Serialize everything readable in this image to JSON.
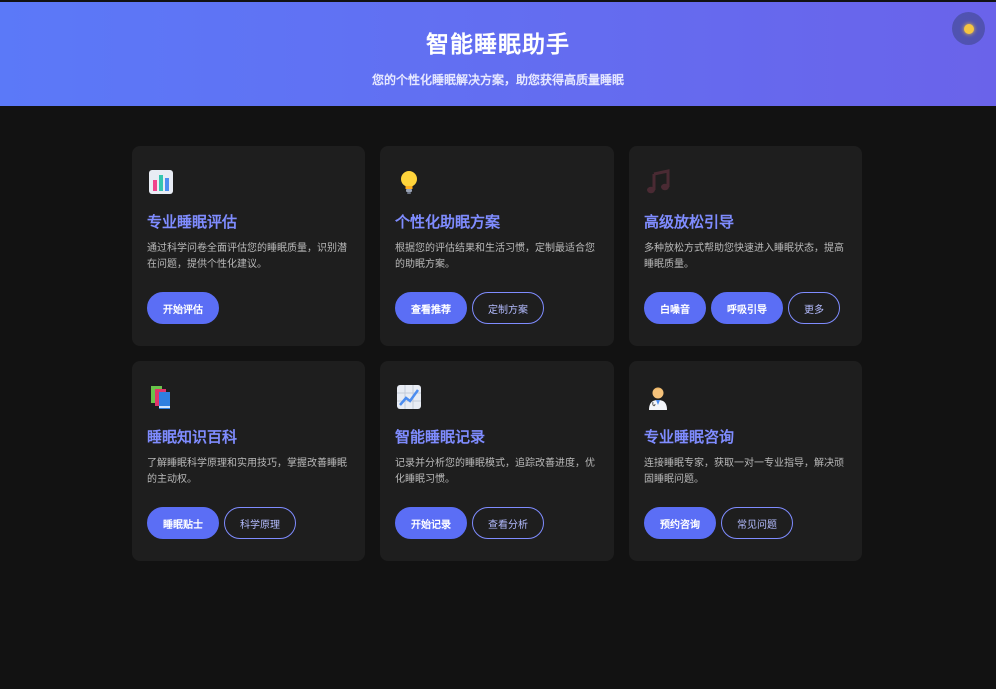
{
  "header": {
    "title": "智能睡眠助手",
    "subtitle": "您的个性化睡眠解决方案，助您获得高质量睡眠"
  },
  "theme_toggle": {
    "icon": "sun-icon",
    "color": "#f5c542"
  },
  "colors": {
    "header_gradient_start": "#5b79f8",
    "header_gradient_end": "#6a63ea",
    "accent": "#5b6ef5",
    "title": "#7f8cff",
    "card_bg": "#1e1e1e",
    "page_bg": "#121212"
  },
  "cards": [
    {
      "icon": "bar-chart-icon",
      "title": "专业睡眠评估",
      "desc": "通过科学问卷全面评估您的睡眠质量，识别潜在问题，提供个性化建议。",
      "buttons": [
        {
          "label": "开始评估",
          "style": "primary"
        }
      ]
    },
    {
      "icon": "light-bulb-icon",
      "title": "个性化助眠方案",
      "desc": "根据您的评估结果和生活习惯，定制最适合您的助眠方案。",
      "buttons": [
        {
          "label": "查看推荐",
          "style": "primary"
        },
        {
          "label": "定制方案",
          "style": "outline"
        }
      ]
    },
    {
      "icon": "music-note-icon",
      "title": "高级放松引导",
      "desc": "多种放松方式帮助您快速进入睡眠状态，提高睡眠质量。",
      "buttons": [
        {
          "label": "白噪音",
          "style": "primary"
        },
        {
          "label": "呼吸引导",
          "style": "primary"
        },
        {
          "label": "更多",
          "style": "outline"
        }
      ]
    },
    {
      "icon": "books-icon",
      "title": "睡眠知识百科",
      "desc": "了解睡眠科学原理和实用技巧，掌握改善睡眠的主动权。",
      "buttons": [
        {
          "label": "睡眠贴士",
          "style": "primary"
        },
        {
          "label": "科学原理",
          "style": "outline"
        }
      ]
    },
    {
      "icon": "trend-chart-icon",
      "title": "智能睡眠记录",
      "desc": "记录并分析您的睡眠模式，追踪改善进度，优化睡眠习惯。",
      "buttons": [
        {
          "label": "开始记录",
          "style": "primary"
        },
        {
          "label": "查看分析",
          "style": "outline"
        }
      ]
    },
    {
      "icon": "doctor-icon",
      "title": "专业睡眠咨询",
      "desc": "连接睡眠专家，获取一对一专业指导，解决顽固睡眠问题。",
      "buttons": [
        {
          "label": "预约咨询",
          "style": "primary"
        },
        {
          "label": "常见问题",
          "style": "outline"
        }
      ]
    }
  ]
}
